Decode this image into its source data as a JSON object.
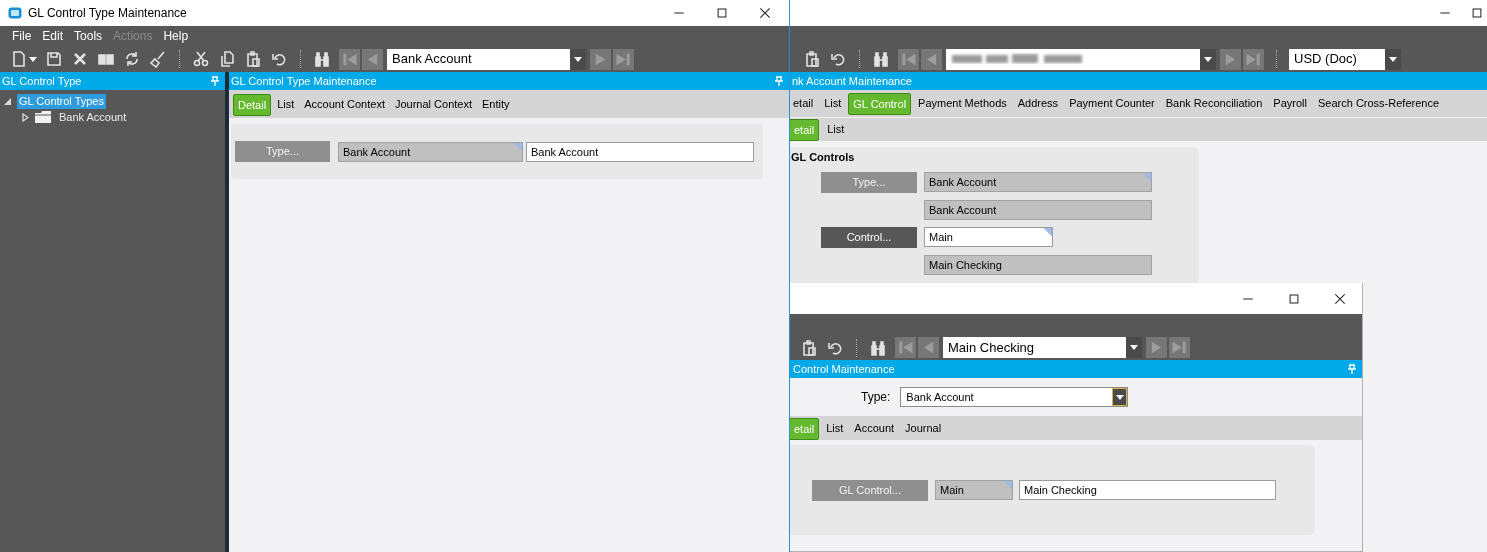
{
  "main_window": {
    "title": "GL Control Type Maintenance",
    "menu": [
      {
        "label": "File",
        "disabled": false
      },
      {
        "label": "Edit",
        "disabled": false
      },
      {
        "label": "Tools",
        "disabled": false
      },
      {
        "label": "Actions",
        "disabled": true
      },
      {
        "label": "Help",
        "disabled": false
      }
    ],
    "record_selector": "Bank Account",
    "tree_panel": {
      "title": "GL Control Type",
      "tree": [
        {
          "label": "GL Control Types",
          "selected": true,
          "expanded": true,
          "children": [
            {
              "label": "Bank Account",
              "selected": false,
              "expanded": false
            }
          ]
        }
      ]
    },
    "detail_panel": {
      "title": "GL Control Type Maintenance",
      "tabs": [
        {
          "label": "Detail",
          "selected": true
        },
        {
          "label": "List",
          "selected": false
        },
        {
          "label": "Account Context",
          "selected": false
        },
        {
          "label": "Journal Context",
          "selected": false
        },
        {
          "label": "Entity",
          "selected": false
        }
      ],
      "fields": [
        {
          "kind": "button",
          "text": "Type...",
          "disabled": true
        },
        {
          "kind": "readonly",
          "text": "Bank Account",
          "corner_mark": true
        },
        {
          "kind": "input",
          "text": "Bank Account",
          "corner_mark": false
        }
      ]
    }
  },
  "bank_account_window": {
    "currency_selector": "USD (Doc)",
    "header": "nk Account Maintenance",
    "tabs": [
      {
        "label": "etail",
        "selected": false
      },
      {
        "label": "List",
        "selected": false
      },
      {
        "label": "GL Control",
        "selected": true
      },
      {
        "label": "Payment Methods",
        "selected": false
      },
      {
        "label": "Address",
        "selected": false
      },
      {
        "label": "Payment Counter",
        "selected": false
      },
      {
        "label": "Bank Reconciliation",
        "selected": false
      },
      {
        "label": "Payroll",
        "selected": false
      },
      {
        "label": "Search Cross-Reference",
        "selected": false
      }
    ],
    "subtabs": [
      {
        "label": "etail",
        "selected": true
      },
      {
        "label": "List",
        "selected": false
      }
    ],
    "group_title": "GL Controls",
    "field_rows": [
      [
        {
          "kind": "button",
          "text": "Type...",
          "disabled": true
        },
        {
          "kind": "readonly",
          "text": "Bank Account",
          "corner_mark": true
        }
      ],
      [
        {
          "kind": "readonly",
          "text": "Bank Account",
          "corner_mark": false
        }
      ],
      [
        {
          "kind": "button",
          "text": "Control...",
          "disabled": false
        },
        {
          "kind": "input",
          "text": "Main",
          "corner_mark": true
        }
      ],
      [
        {
          "kind": "readonly",
          "text": "Main Checking",
          "corner_mark": false
        }
      ]
    ]
  },
  "gl_control_window": {
    "record_selector": "Main Checking",
    "header": "Control Maintenance",
    "type_label": "Type:",
    "type_value": "Bank Account",
    "tabs": [
      {
        "label": "etail",
        "selected": true
      },
      {
        "label": "List",
        "selected": false
      },
      {
        "label": "Account",
        "selected": false
      },
      {
        "label": "Journal",
        "selected": false
      }
    ],
    "fields": [
      {
        "kind": "button",
        "text": "GL Control...",
        "disabled": true
      },
      {
        "kind": "readonly",
        "text": "Main",
        "corner_mark": true
      },
      {
        "kind": "input",
        "text": "Main Checking",
        "corner_mark": false
      }
    ]
  }
}
